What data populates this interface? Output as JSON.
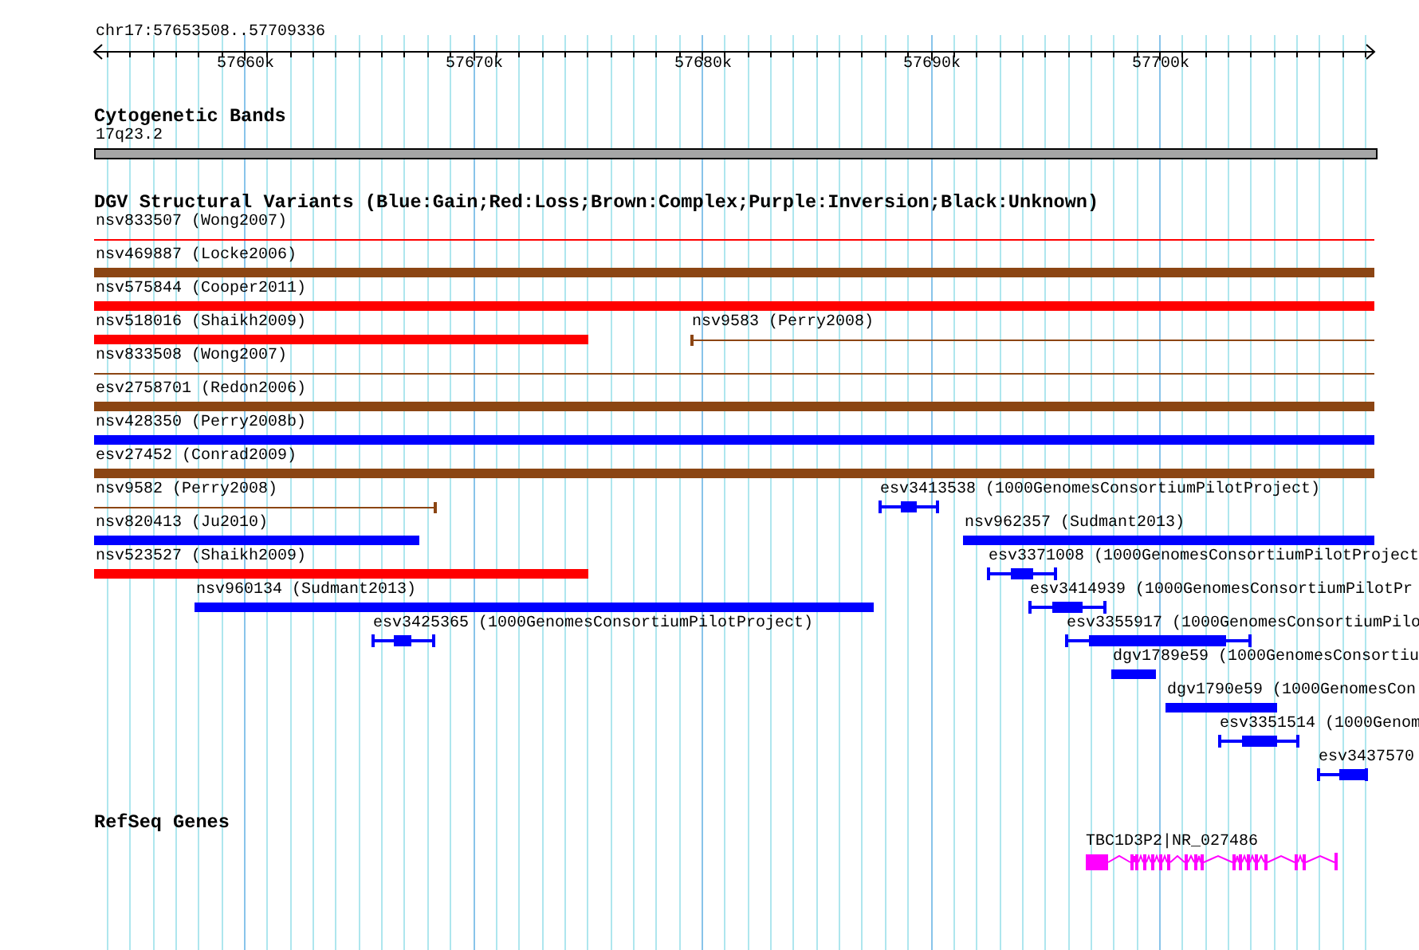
{
  "ruler": {
    "region": "chr17:57653508..57709336",
    "ticks": [
      "57660k",
      "57670k",
      "57680k",
      "57690k",
      "57700k"
    ]
  },
  "cytogenetic_bands": {
    "title": "Cytogenetic Bands",
    "bands": [
      {
        "label": "17q23.2"
      }
    ]
  },
  "dgv_variants": {
    "title": "DGV Structural Variants (Blue:Gain;Red:Loss;Brown:Complex;Purple:Inversion;Black:Unknown)",
    "features": [
      {
        "label": "nsv833507 (Wong2007)",
        "color": "#ff0000",
        "kind": "line"
      },
      {
        "label": "nsv469887 (Locke2006)",
        "color": "#8b4513",
        "kind": "bar"
      },
      {
        "label": "nsv575844 (Cooper2011)",
        "color": "#ff0000",
        "kind": "bar"
      },
      {
        "label": "nsv518016 (Shaikh2009)",
        "color": "#ff0000",
        "kind": "bar"
      },
      {
        "label": "nsv9583 (Perry2008)",
        "color": "#8b4513",
        "kind": "line"
      },
      {
        "label": "nsv833508 (Wong2007)",
        "color": "#8b4513",
        "kind": "line"
      },
      {
        "label": "esv2758701 (Redon2006)",
        "color": "#8b4513",
        "kind": "bar"
      },
      {
        "label": "nsv428350 (Perry2008b)",
        "color": "#0000ff",
        "kind": "bar"
      },
      {
        "label": "esv27452 (Conrad2009)",
        "color": "#8b4513",
        "kind": "bar"
      },
      {
        "label": "nsv9582 (Perry2008)",
        "color": "#8b4513",
        "kind": "line"
      },
      {
        "label": "esv3413538 (1000GenomesConsortiumPilotProject)",
        "color": "#0000ff",
        "kind": "dumbbell"
      },
      {
        "label": "nsv820413 (Ju2010)",
        "color": "#0000ff",
        "kind": "bar"
      },
      {
        "label": "nsv962357 (Sudmant2013)",
        "color": "#0000ff",
        "kind": "bar"
      },
      {
        "label": "nsv523527 (Shaikh2009)",
        "color": "#ff0000",
        "kind": "bar"
      },
      {
        "label": "esv3371008 (1000GenomesConsortiumPilotProject",
        "color": "#0000ff",
        "kind": "dumbbell"
      },
      {
        "label": "nsv960134 (Sudmant2013)",
        "color": "#0000ff",
        "kind": "bar"
      },
      {
        "label": "esv3414939 (1000GenomesConsortiumPilotPr",
        "color": "#0000ff",
        "kind": "dumbbell"
      },
      {
        "label": "esv3425365 (1000GenomesConsortiumPilotProject)",
        "color": "#0000ff",
        "kind": "dumbbell"
      },
      {
        "label": "esv3355917 (1000GenomesConsortiumPilo",
        "color": "#0000ff",
        "kind": "dumbbell"
      },
      {
        "label": "dgv1789e59 (1000GenomesConsortiu",
        "color": "#0000ff",
        "kind": "bar"
      },
      {
        "label": "dgv1790e59 (1000GenomesCon",
        "color": "#0000ff",
        "kind": "bar"
      },
      {
        "label": "esv3351514 (1000Genom",
        "color": "#0000ff",
        "kind": "dumbbell"
      },
      {
        "label": "esv3437570",
        "color": "#0000ff",
        "kind": "dumbbell"
      }
    ]
  },
  "refseq_genes": {
    "title": "RefSeq Genes",
    "genes": [
      {
        "label": "TBC1D3P2|NR_027486",
        "color": "#ff00ff"
      }
    ]
  }
}
